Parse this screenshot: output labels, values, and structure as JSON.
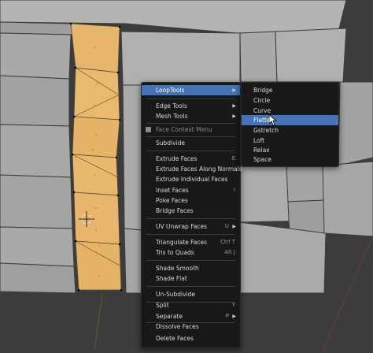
{
  "context_menu": {
    "items": [
      {
        "label": "LoopTools",
        "shortcut": "",
        "submenu": true,
        "state": "highlight"
      },
      {
        "label": "Edge Tools",
        "shortcut": "",
        "submenu": true,
        "state": "normal"
      },
      {
        "label": "Mesh Tools",
        "shortcut": "",
        "submenu": true,
        "state": "normal"
      },
      {
        "label": "Face Context Menu",
        "shortcut": "",
        "submenu": false,
        "state": "disabled"
      },
      {
        "label": "Subdivide",
        "shortcut": "",
        "submenu": false,
        "state": "normal"
      },
      {
        "label": "Extrude Faces",
        "shortcut": "E",
        "submenu": false,
        "state": "normal"
      },
      {
        "label": "Extrude Faces Along Normals",
        "shortcut": "",
        "submenu": false,
        "state": "normal"
      },
      {
        "label": "Extrude Individual Faces",
        "shortcut": "",
        "submenu": false,
        "state": "normal"
      },
      {
        "label": "Inset Faces",
        "shortcut": "I",
        "submenu": false,
        "state": "normal"
      },
      {
        "label": "Poke Faces",
        "shortcut": "",
        "submenu": false,
        "state": "normal"
      },
      {
        "label": "Bridge Faces",
        "shortcut": "",
        "submenu": false,
        "state": "normal"
      },
      {
        "label": "UV Unwrap Faces",
        "shortcut": "U",
        "submenu": true,
        "state": "normal"
      },
      {
        "label": "Triangulate Faces",
        "shortcut": "Ctrl T",
        "submenu": false,
        "state": "normal"
      },
      {
        "label": "Tris to Quads",
        "shortcut": "Alt J",
        "submenu": false,
        "state": "normal"
      },
      {
        "label": "Shade Smooth",
        "shortcut": "",
        "submenu": false,
        "state": "normal"
      },
      {
        "label": "Shade Flat",
        "shortcut": "",
        "submenu": false,
        "state": "normal"
      },
      {
        "label": "Un-Subdivide",
        "shortcut": "",
        "submenu": false,
        "state": "normal"
      },
      {
        "label": "Split",
        "shortcut": "Y",
        "submenu": false,
        "state": "normal"
      },
      {
        "label": "Separate",
        "shortcut": "P",
        "submenu": true,
        "state": "normal"
      },
      {
        "label": "Dissolve Faces",
        "shortcut": "",
        "submenu": false,
        "state": "normal"
      },
      {
        "label": "Delete Faces",
        "shortcut": "",
        "submenu": false,
        "state": "normal"
      }
    ]
  },
  "looptools_menu": {
    "items": [
      {
        "label": "Bridge",
        "state": "normal"
      },
      {
        "label": "Circle",
        "state": "normal"
      },
      {
        "label": "Curve",
        "state": "normal"
      },
      {
        "label": "Flatten",
        "state": "highlight"
      },
      {
        "label": "Gstretch",
        "state": "normal"
      },
      {
        "label": "Loft",
        "state": "normal"
      },
      {
        "label": "Relax",
        "state": "normal"
      },
      {
        "label": "Space",
        "state": "normal"
      }
    ]
  },
  "icons": {
    "face_context_menu": "face-mode-icon",
    "cursor": "mouse-pointer-icon",
    "origin": "3d-cursor-icon"
  },
  "colors": {
    "background": "#3d3d3d",
    "mesh": "#a8a8a8",
    "selected_face": "#e7b56b",
    "menu_bg": "#181818",
    "highlight": "#4772b3"
  }
}
